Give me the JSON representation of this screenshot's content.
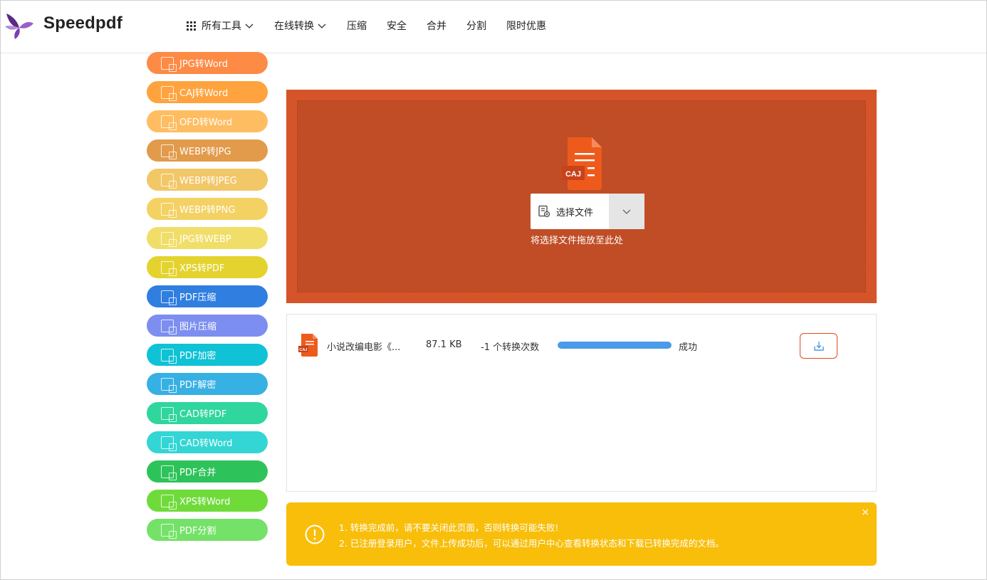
{
  "brand": {
    "name": "Speedpdf"
  },
  "nav": [
    {
      "label": "所有工具",
      "icon": "grid-icon",
      "dropdown": true
    },
    {
      "label": "在线转换",
      "dropdown": true
    },
    {
      "label": "压缩",
      "dropdown": false
    },
    {
      "label": "安全",
      "dropdown": false
    },
    {
      "label": "合并",
      "dropdown": false
    },
    {
      "label": "分割",
      "dropdown": false
    },
    {
      "label": "限时优惠",
      "dropdown": false
    }
  ],
  "sidebar": [
    {
      "label": "JPG转Word",
      "color": "#fd8a45"
    },
    {
      "label": "CAJ转Word",
      "color": "#ffa33f"
    },
    {
      "label": "OFD转Word",
      "color": "#ffbd62"
    },
    {
      "label": "WEBP转JPG",
      "color": "#e29a4b"
    },
    {
      "label": "WEBP转JPEG",
      "color": "#f2c768"
    },
    {
      "label": "WEBP转PNG",
      "color": "#f4d163"
    },
    {
      "label": "JPG转WEBP",
      "color": "#f1de68"
    },
    {
      "label": "XPS转PDF",
      "color": "#e4d32e"
    },
    {
      "label": "PDF压缩",
      "color": "#2f7ee0"
    },
    {
      "label": "图片压缩",
      "color": "#7c8ef0"
    },
    {
      "label": "PDF加密",
      "color": "#0fc2d6"
    },
    {
      "label": "PDF解密",
      "color": "#37b0e3"
    },
    {
      "label": "CAD转PDF",
      "color": "#2fd69d"
    },
    {
      "label": "CAD转Word",
      "color": "#33d6d4"
    },
    {
      "label": "PDF合并",
      "color": "#2ec35a"
    },
    {
      "label": "XPS转Word",
      "color": "#6fdb3a"
    },
    {
      "label": "PDF分割",
      "color": "#74e268"
    }
  ],
  "upload": {
    "file_type_badge": "CAJ",
    "select_label": "选择文件",
    "drop_hint": "将选择文件拖放至此处"
  },
  "file": {
    "name": "小说改编电影《...",
    "size": "87.1 KB",
    "conversions": "-1 个转换次数",
    "progress": 1.0,
    "status": "成功",
    "badge": "CAJ"
  },
  "notice": {
    "line1": "1. 转换完成前，请不要关闭此页面，否则转换可能失败!",
    "line2": "2. 已注册登录用户，文件上传成功后，可以通过用户中心查看转换状态和下载已转换完成的文档。",
    "close": "×"
  },
  "colors": {
    "upload_bg": "#d65429",
    "upload_inner": "#c04d26",
    "notice_bg": "#f8be0a",
    "progress": "#4a9be8",
    "download_border": "#e04a1f"
  }
}
